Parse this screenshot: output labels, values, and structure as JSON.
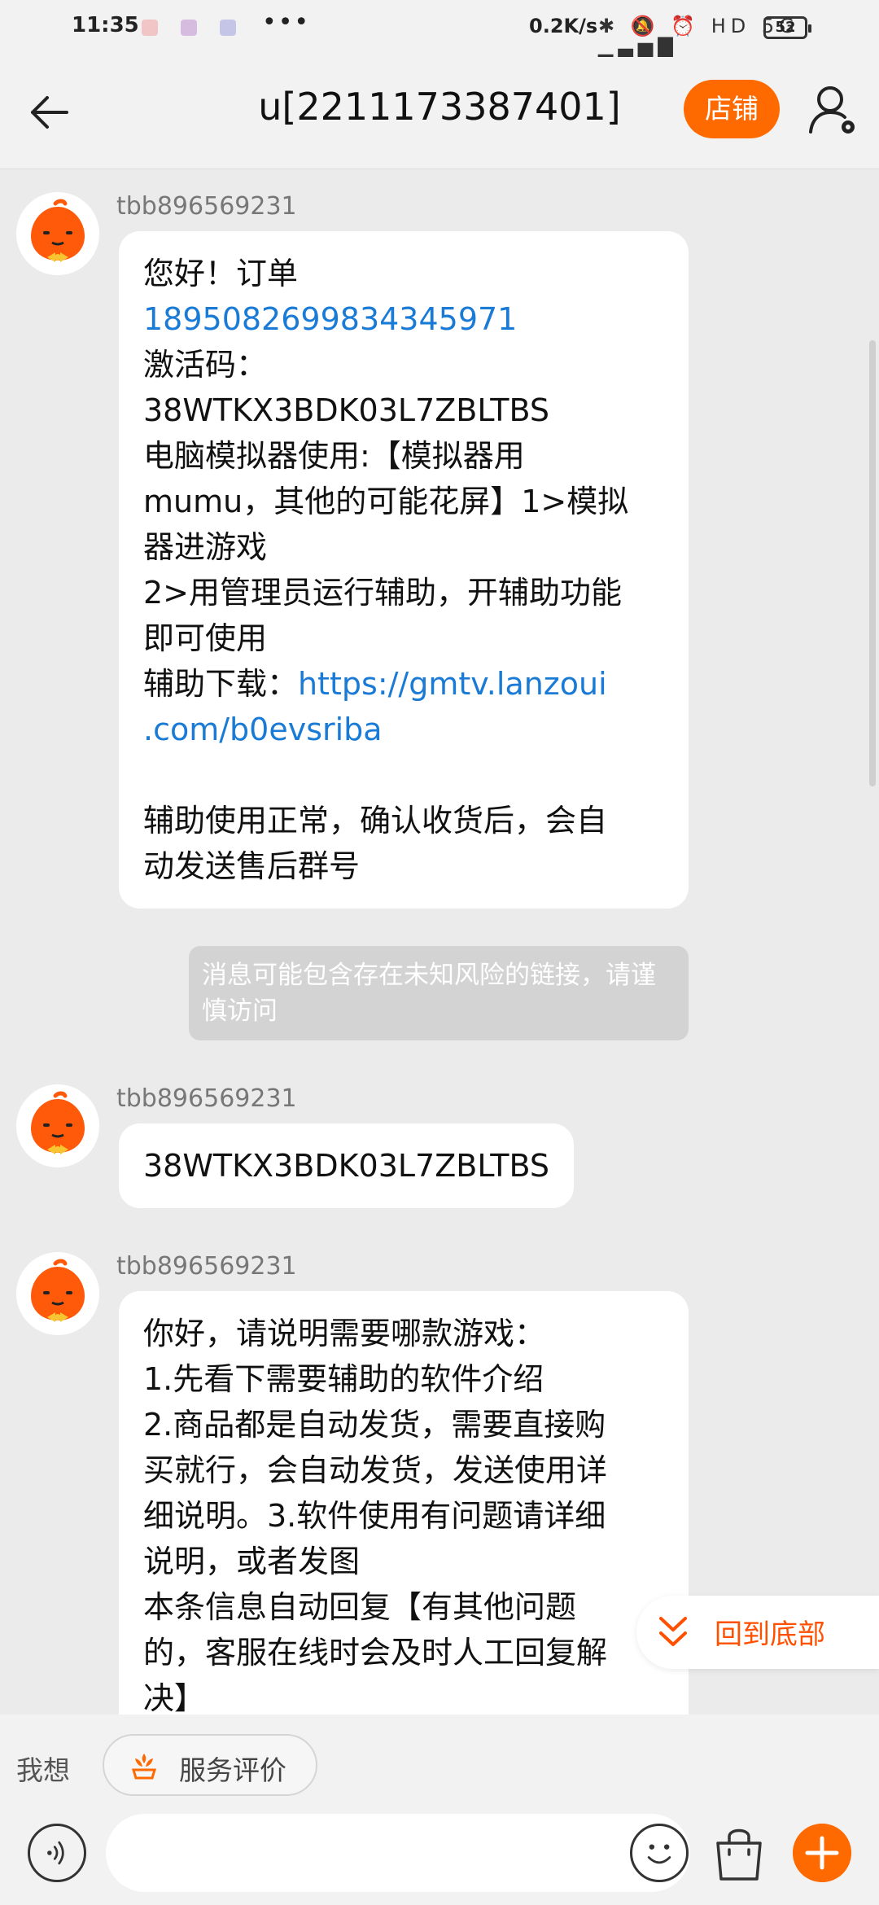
{
  "status_bar": {
    "time": "11:35",
    "net_speed": "0.2K/s",
    "indicator_icons": "✱ 🔕 ⏰ HD 5G ▂▄▆█",
    "battery": "52"
  },
  "header": {
    "title": "u[2211173387401]",
    "shop_label": "店铺"
  },
  "messages": [
    {
      "sender": "tbb896569231",
      "lines": [
        "您好！订单",
        "1895082699834345971",
        "激活码：",
        "38WTKX3BDK03L7ZBLTBS",
        "电脑模拟器使用:【模拟器用",
        "mumu，其他的可能花屏】1>模拟",
        "器进游戏",
        "2>用管理员运行辅助，开辅助功能",
        "即可使用",
        "辅助下载：",
        "https://gmtv.lanzoui",
        ".com/b0evsriba",
        "",
        "辅助使用正常，确认收货后，会自",
        "动发送售后群号"
      ]
    },
    {
      "sender": "tbb896569231",
      "lines": [
        "38WTKX3BDK03L7ZBLTBS"
      ]
    },
    {
      "sender": "tbb896569231",
      "lines": [
        "你好，请说明需要哪款游戏：",
        "1.先看下需要辅助的软件介绍",
        "2.商品都是自动发货，需要直接购",
        "买就行，会自动发货，发送使用详",
        "细说明。3.软件使用有问题请详细",
        "说明，或者发图",
        "本条信息自动回复【有其他问题",
        "的，客服在线时会及时人工回复解",
        "决】"
      ]
    }
  ],
  "link_warning": "消息可能包含存在未知风险的链接，请谨慎访问",
  "back_to_bottom": "回到底部",
  "quick_bar": {
    "label": "我想",
    "chip": "服务评价"
  },
  "colors": {
    "accent": "#ff6a00",
    "link": "#1a7bd6"
  },
  "icons": [
    "back-arrow-icon",
    "profile-settings-icon",
    "mascot-avatar-icon",
    "chevron-double-down-icon",
    "service-rating-icon",
    "voice-icon",
    "emoji-icon",
    "shopping-bag-icon",
    "plus-icon"
  ]
}
